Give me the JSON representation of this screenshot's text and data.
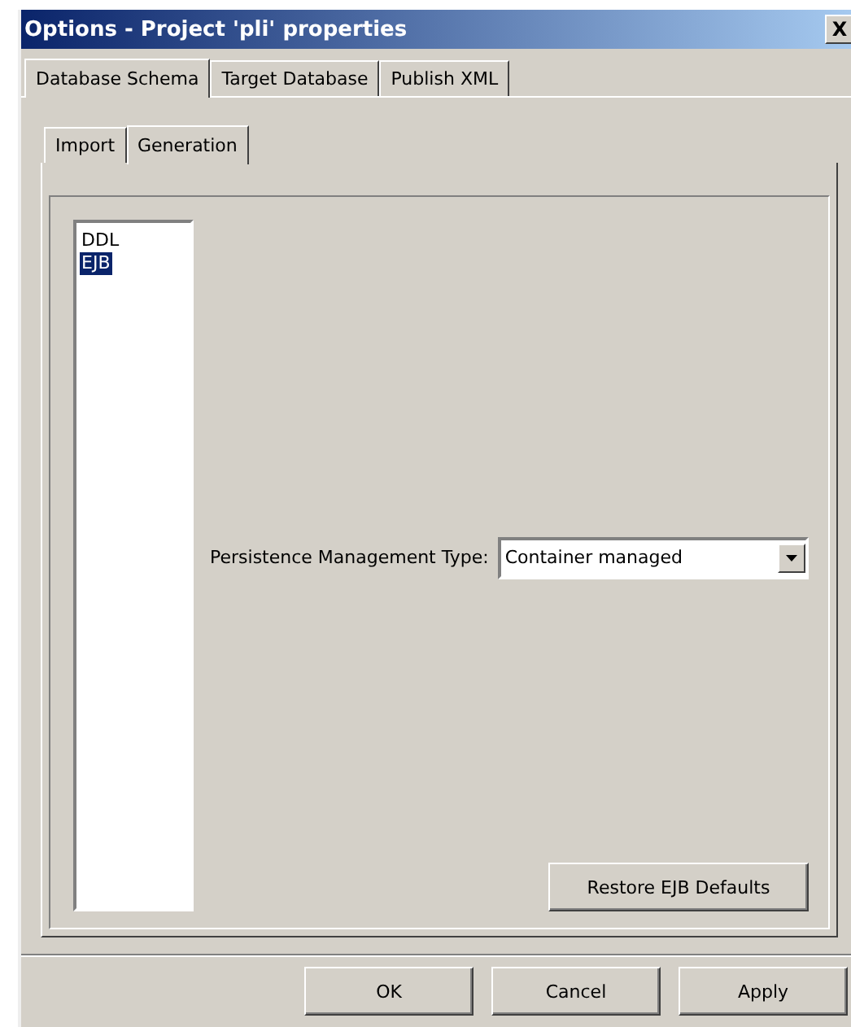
{
  "window": {
    "title": "Options - Project 'pli' properties",
    "close": "X"
  },
  "tabs": [
    {
      "label": "Database Schema",
      "selected": true
    },
    {
      "label": "Target Database",
      "selected": false
    },
    {
      "label": "Publish XML",
      "selected": false
    }
  ],
  "subtabs": [
    {
      "label": "Import",
      "selected": false
    },
    {
      "label": "Generation",
      "selected": true
    }
  ],
  "list": [
    {
      "label": "DDL",
      "selected": false
    },
    {
      "label": "EJB",
      "selected": true
    }
  ],
  "persistence": {
    "label": "Persistence Management Type:",
    "value": "Container managed"
  },
  "restore_button": {
    "label": "Restore EJB Defaults"
  },
  "buttons": [
    {
      "label": "OK"
    },
    {
      "label": "Cancel"
    },
    {
      "label": "Apply"
    }
  ]
}
